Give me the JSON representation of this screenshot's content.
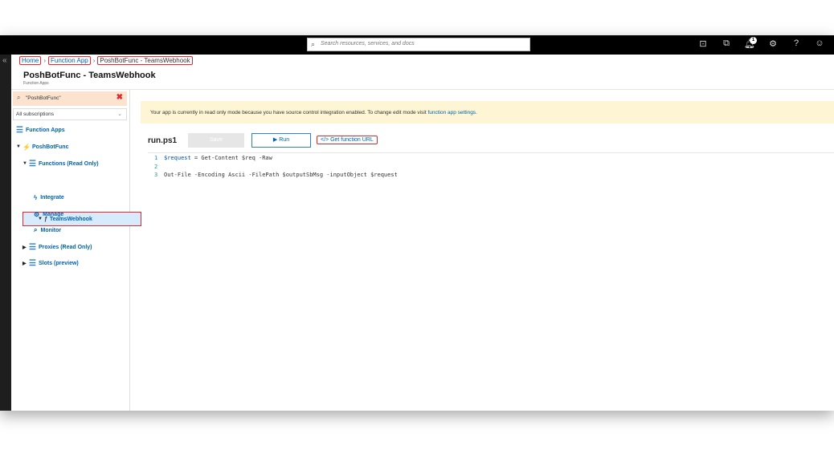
{
  "topbar": {
    "search_placeholder": "Search resources, services, and docs",
    "icons": [
      "cloud-shell-icon",
      "directory-filter-icon",
      "notifications-icon",
      "settings-icon",
      "help-icon",
      "feedback-icon"
    ],
    "notification_count": "1"
  },
  "breadcrumb": {
    "home": "Home",
    "function_app": "Function App",
    "current": "PoshBotFunc - TeamsWebhook"
  },
  "header": {
    "title": "PoshBotFunc - TeamsWebhook",
    "subtitle": "Function Apps"
  },
  "sidebar": {
    "filter_value": "\"PoshBotFunc\"",
    "subscriptions": "All subscriptions",
    "items": [
      {
        "label": "Function Apps"
      },
      {
        "label": "PoshBotFunc"
      },
      {
        "label": "Functions (Read Only)"
      },
      {
        "label": "TeamsWebhook"
      },
      {
        "label": "Integrate"
      },
      {
        "label": "Manage"
      },
      {
        "label": "Monitor"
      },
      {
        "label": "Proxies (Read Only)"
      },
      {
        "label": "Slots (preview)"
      }
    ]
  },
  "banner": {
    "text": "Your app is currently in read only mode because you have source control integration enabled. To change edit mode visit ",
    "link": "function app settings."
  },
  "editor": {
    "filename": "run.ps1",
    "save_label": "Save",
    "run_label": "Run",
    "get_url_label": "</> Get function URL",
    "lines": [
      {
        "n": "1",
        "var": "$request",
        "rest": " = Get-Content $req -Raw"
      },
      {
        "n": "2",
        "var": "",
        "rest": ""
      },
      {
        "n": "3",
        "var": "",
        "rest": "Out-File -Encoding Ascii -FilePath $outputSbMsg -inputObject $request"
      }
    ]
  },
  "colors": {
    "accent": "#0062ad",
    "highlight": "#e0282f",
    "banner_bg": "#fdf5d4",
    "filter_bg": "#fbe3cf"
  }
}
